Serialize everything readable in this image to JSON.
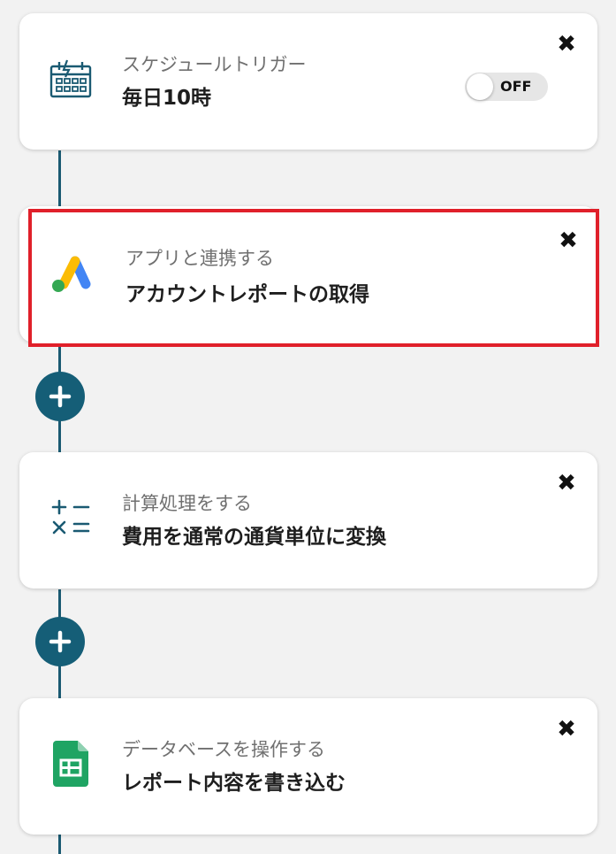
{
  "flow": {
    "steps": [
      {
        "label": "スケジュールトリガー",
        "title": "毎日10時",
        "icon": "calendar-clock-icon",
        "toggle_label": "OFF",
        "close": "✖"
      },
      {
        "label": "アプリと連携する",
        "title": "アカウントレポートの取得",
        "icon": "google-ads-icon",
        "close": "✖"
      },
      {
        "label": "計算処理をする",
        "title": "費用を通常の通貨単位に変換",
        "icon": "calculator-operators-icon",
        "close": "✖"
      },
      {
        "label": "データベースを操作する",
        "title": "レポート内容を書き込む",
        "icon": "google-sheets-icon",
        "close": "✖"
      }
    ],
    "add_step_symbol": "+",
    "colors": {
      "accent": "#155e77",
      "highlight": "#e0202a"
    }
  }
}
